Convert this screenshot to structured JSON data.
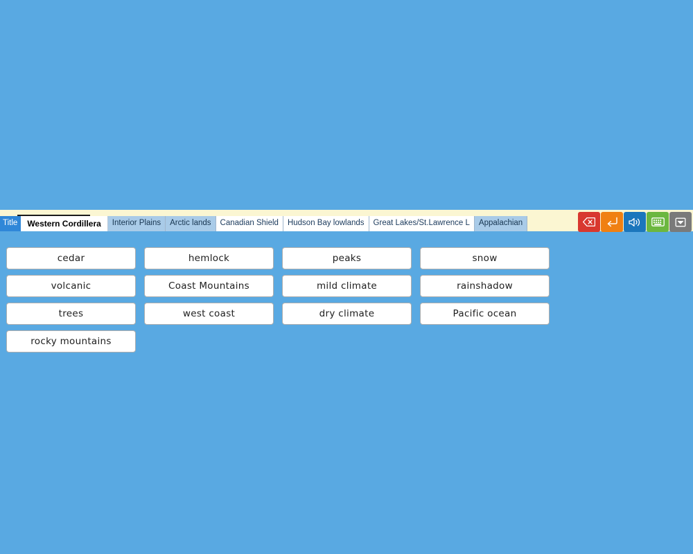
{
  "background_color": "#59a9e2",
  "toolbar": {
    "strip_color": "#fbf6d2",
    "title_tab": {
      "label": "Title",
      "color": "#2f87d8"
    },
    "tabs": [
      {
        "label": "Western Cordillera",
        "state": "active"
      },
      {
        "label": "Interior Plains",
        "state": "shaded"
      },
      {
        "label": "Arctic lands",
        "state": "shaded"
      },
      {
        "label": "Canadian Shield",
        "state": "plain"
      },
      {
        "label": "Hudson Bay lowlands",
        "state": "plain"
      },
      {
        "label": "Great Lakes/St.Lawrence L",
        "state": "plain"
      },
      {
        "label": "Appalachian",
        "state": "shaded"
      }
    ],
    "keys": [
      {
        "name": "backspace-key",
        "icon": "backspace-icon",
        "color": "#d8382f"
      },
      {
        "name": "enter-key",
        "icon": "enter-arrow-icon",
        "color": "#f08012"
      },
      {
        "name": "sound-key",
        "icon": "speaker-icon",
        "color": "#1b76bc"
      },
      {
        "name": "keyboard-key",
        "icon": "keyboard-icon",
        "color": "#6cb73f"
      },
      {
        "name": "collapse-key",
        "icon": "collapse-chevron-icon",
        "color": "#7a7a7a"
      }
    ]
  },
  "word_bank": {
    "words": [
      "cedar",
      "hemlock",
      "peaks",
      "snow",
      "volcanic",
      "Coast Mountains",
      "mild climate",
      "rainshadow",
      "trees",
      "west coast",
      "dry climate",
      "Pacific ocean",
      "rocky mountains"
    ]
  }
}
